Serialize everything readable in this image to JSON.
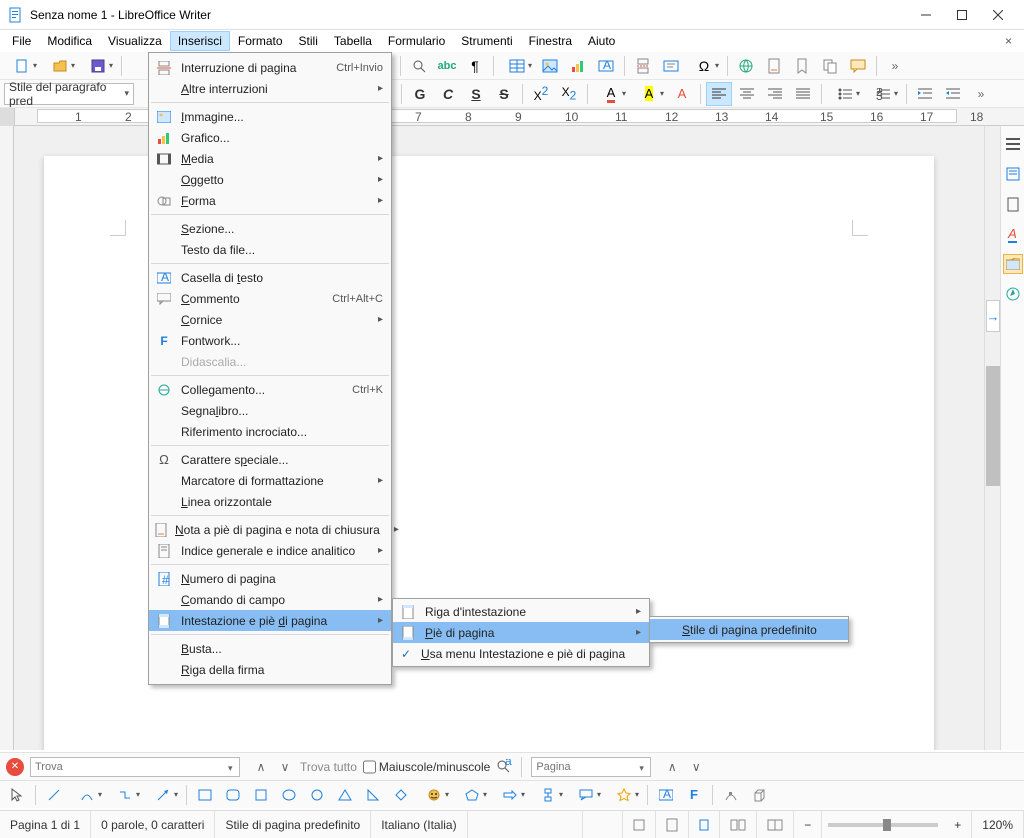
{
  "window": {
    "title": "Senza nome 1 - LibreOffice Writer"
  },
  "menubar": {
    "items": [
      "File",
      "Modifica",
      "Visualizza",
      "Inserisci",
      "Formato",
      "Stili",
      "Tabella",
      "Formulario",
      "Strumenti",
      "Finestra",
      "Aiuto"
    ],
    "active_index": 3
  },
  "para_style_combo": "Stile del paragrafo pred",
  "toolbar2_letters": [
    "G",
    "C",
    "S",
    "S"
  ],
  "ruler_numbers": [
    "1",
    "2",
    "7",
    "8",
    "9",
    "10",
    "11",
    "12",
    "13",
    "14",
    "15",
    "16",
    "17",
    "18"
  ],
  "insert_menu": {
    "items": [
      {
        "label": "Interruzione di pagina",
        "shortcut": "Ctrl+Invio",
        "icon": "page-break"
      },
      {
        "label": "Altre interruzioni",
        "submenu": true
      },
      {
        "sep": true
      },
      {
        "label": "Immagine...",
        "icon": "image",
        "u": 0
      },
      {
        "label": "Grafico...",
        "icon": "chart"
      },
      {
        "label": "Media",
        "icon": "media",
        "submenu": true,
        "u": 0
      },
      {
        "label": "Oggetto",
        "submenu": true,
        "u": 0
      },
      {
        "label": "Forma",
        "icon": "shape",
        "submenu": true,
        "u": 0
      },
      {
        "sep": true
      },
      {
        "label": "Sezione...",
        "u": 0
      },
      {
        "label": "Testo da file..."
      },
      {
        "sep": true
      },
      {
        "label": "Casella di testo",
        "icon": "textbox",
        "uidx": 11
      },
      {
        "label": "Commento",
        "icon": "comment",
        "shortcut": "Ctrl+Alt+C",
        "u": 0
      },
      {
        "label": "Cornice",
        "submenu": true,
        "u": 0
      },
      {
        "label": "Fontwork...",
        "icon": "fontwork"
      },
      {
        "label": "Didascalia...",
        "disabled": true
      },
      {
        "sep": true
      },
      {
        "label": "Collegamento...",
        "icon": "link",
        "shortcut": "Ctrl+K",
        "uidx": 5
      },
      {
        "label": "Segnalibro...",
        "uidx": 5
      },
      {
        "label": "Riferimento incrociato..."
      },
      {
        "sep": true
      },
      {
        "label": "Carattere speciale...",
        "icon": "omega",
        "uidx": 10
      },
      {
        "label": "Marcatore di formattazione",
        "submenu": true
      },
      {
        "label": "Linea orizzontale",
        "u": 0
      },
      {
        "sep": true
      },
      {
        "label": "Nota a piè di pagina e nota di chiusura",
        "icon": "footnote",
        "submenu": true,
        "u": 0
      },
      {
        "label": "Indice generale e indice analitico",
        "icon": "index",
        "submenu": true
      },
      {
        "sep": true
      },
      {
        "label": "Numero di pagina",
        "icon": "pagenum",
        "u": 0
      },
      {
        "label": "Comando di campo",
        "submenu": true,
        "u": 0
      },
      {
        "label": "Intestazione e piè di pagina",
        "icon": "headerfooter",
        "submenu": true,
        "hl": true,
        "uidx": 17
      },
      {
        "sep": true
      },
      {
        "label": "Busta...",
        "u": 0
      },
      {
        "label": "Riga della firma",
        "u": 0
      }
    ]
  },
  "submenu_headerfooter": {
    "items": [
      {
        "label": "Riga d'intestazione",
        "icon": "page",
        "submenu": true
      },
      {
        "label": "Piè di pagina",
        "icon": "page",
        "submenu": true,
        "hl": true,
        "u": 0
      },
      {
        "label": "Usa menu Intestazione e piè di pagina",
        "check": true,
        "u": 0
      }
    ]
  },
  "submenu_style": {
    "items": [
      {
        "label": "Stile di pagina predefinito",
        "hl": true,
        "u": 0
      }
    ]
  },
  "findbar": {
    "placeholder": "Trova",
    "findall": "Trova tutto",
    "matchcase": "Maiuscole/minuscole",
    "nav_placeholder": "Pagina"
  },
  "statusbar": {
    "page": "Pagina 1 di 1",
    "words": "0 parole, 0 caratteri",
    "pagestyle": "Stile di pagina predefinito",
    "lang": "Italiano (Italia)",
    "zoom": "120%"
  }
}
